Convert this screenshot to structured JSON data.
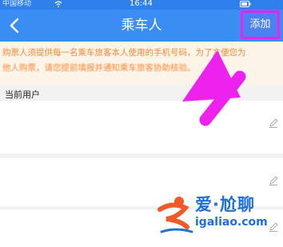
{
  "status_bar": {
    "carrier": "中国移动",
    "time": "16:44"
  },
  "nav": {
    "title": "乘车人",
    "add_label": "添加",
    "back_icon": "chevron-left-icon"
  },
  "notice": {
    "line1": "购票人须提供每一名乘车旅客本人使用的手机号码，为了方便您为",
    "line2": "他人购票，请您提前填报并通知乘车旅客协助核验。"
  },
  "section": {
    "current_user": "当前用户"
  },
  "passenger_cards": [
    {
      "edit_icon": "edit-pencil-icon"
    },
    {
      "edit_icon": "edit-pencil-icon"
    },
    {
      "edit_icon": "edit-pencil-icon"
    }
  ],
  "watermark": {
    "name": "爱·尬聊",
    "url": "igaliao.com"
  },
  "colors": {
    "nav_blue": "#3a8df2",
    "notice_bg": "#fdf4e8",
    "notice_text": "#f08a3c",
    "highlight_magenta": "#ee22ee"
  }
}
